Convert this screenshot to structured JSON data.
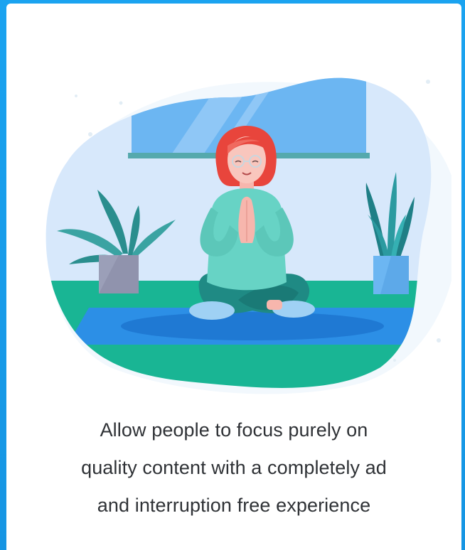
{
  "caption": {
    "line1": "Allow people to focus purely on",
    "line2": "quality content with a completely ad",
    "line3": "and interruption free experience"
  },
  "colors": {
    "frame_blue": "#1a9be8",
    "card_bg": "#ffffff",
    "blob_light": "#dbeafb",
    "wall_window": "#6ab4f0",
    "floor_green": "#1ab394",
    "mat_blue": "#2f8ee8",
    "shirt": "#67d3c5",
    "pants": "#1f8a84",
    "hair": "#e8453c",
    "caption_text": "#2f3236"
  },
  "icons": {
    "illustration": "meditating-woman-illustration",
    "left_plant": "potted-palm-plant-icon",
    "right_plant": "potted-snake-plant-icon"
  }
}
